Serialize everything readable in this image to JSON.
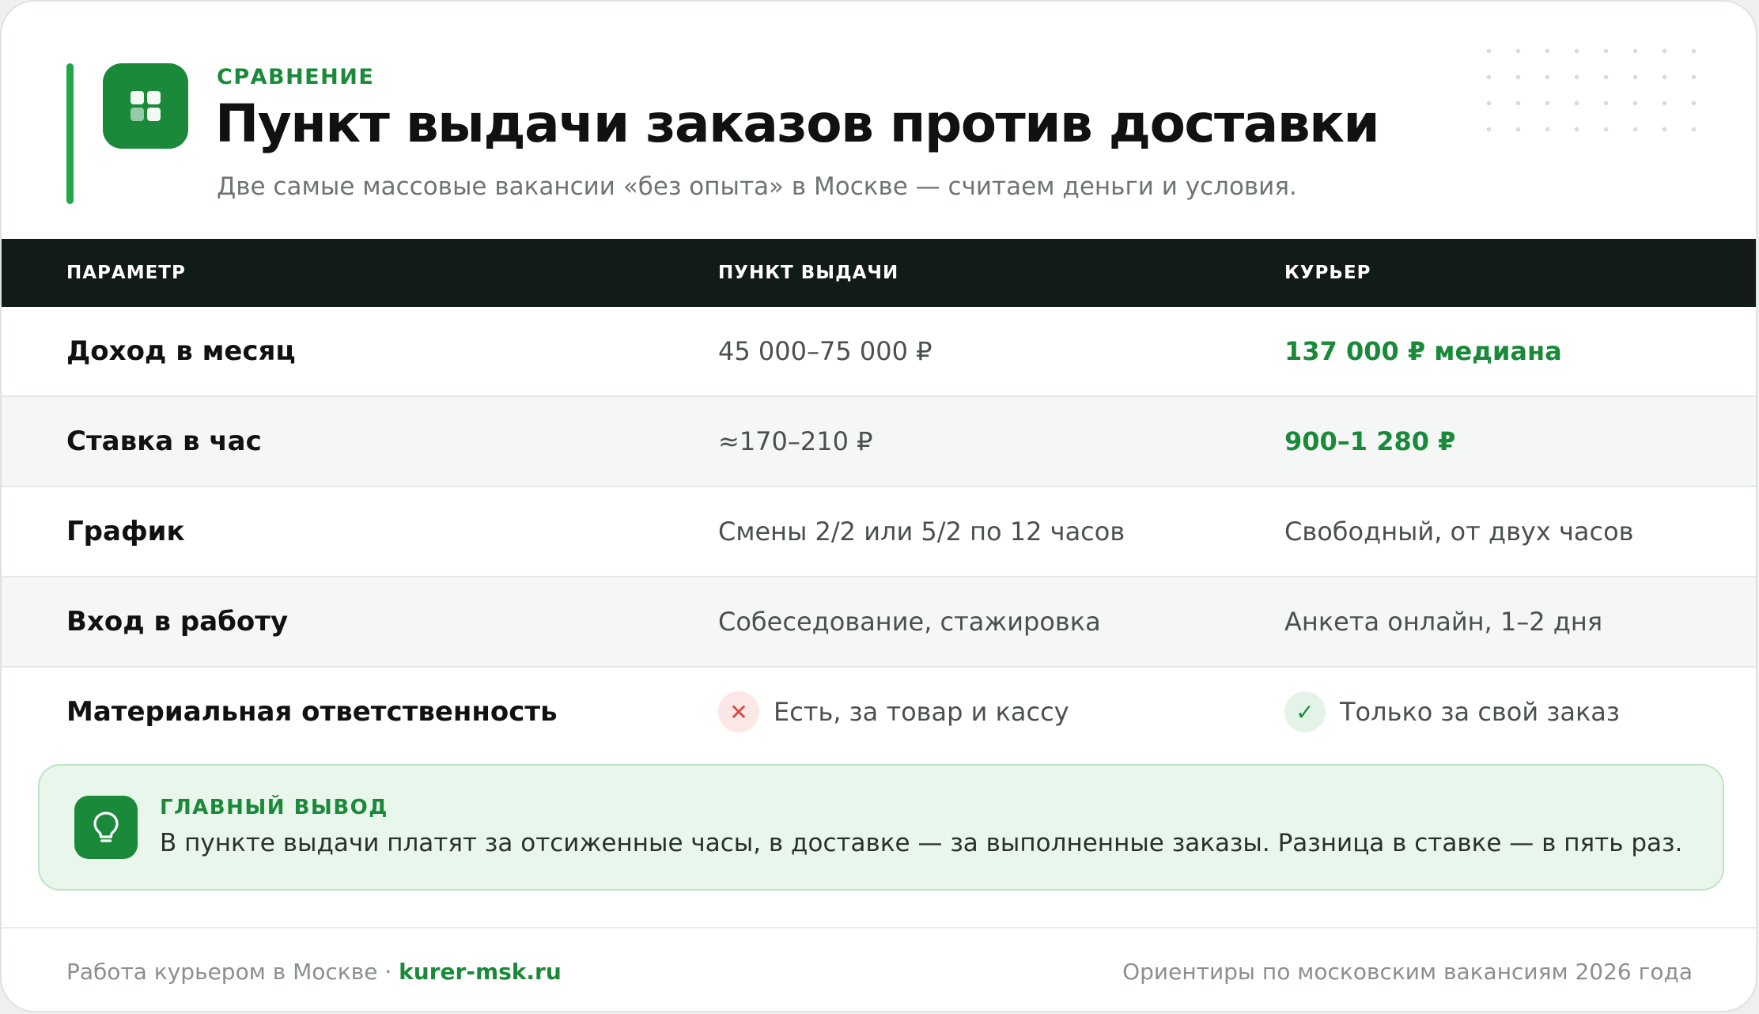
{
  "header": {
    "eyebrow": "СРАВНЕНИЕ",
    "title": "Пункт выдачи заказов против доставки",
    "subtitle": "Две самые массовые вакансии «без опыта» в Москве — считаем деньги и условия."
  },
  "table": {
    "columns": [
      "ПАРАМЕТР",
      "ПУНКТ ВЫДАЧИ",
      "КУРЬЕР"
    ],
    "rows": [
      {
        "param": "Доход в месяц",
        "pvz": "45 000–75 000 ₽",
        "courier": "137 000 ₽ медиана"
      },
      {
        "param": "Ставка в час",
        "pvz": "≈170–210 ₽",
        "courier": "900–1 280 ₽"
      },
      {
        "param": "График",
        "pvz": "Смены 2/2 или 5/2 по 12 часов",
        "courier": "Свободный, от двух часов"
      },
      {
        "param": "Вход в работу",
        "pvz": "Собеседование, стажировка",
        "courier": "Анкета онлайн, 1–2 дня"
      },
      {
        "param": "Материальная ответственность",
        "pvz": "Есть, за товар и кассу",
        "courier": "Только за свой заказ"
      }
    ]
  },
  "conclusion": {
    "label": "ГЛАВНЫЙ ВЫВОД",
    "text": "В пункте выдачи платят за отсиженные часы, в доставке — за выполненные заказы. Разница в ставке — в пять раз."
  },
  "footer": {
    "left_text": "Работа курьером в Москве ·",
    "site": "kurer-msk.ru",
    "right_text": "Ориентиры по московским вакансиям 2026 года"
  },
  "icons": {
    "logo": "grid-icon",
    "cross": "cross-icon",
    "check": "check-icon",
    "bulb": "lightbulb-icon"
  },
  "colors": {
    "accent": "#1a8a3a",
    "header_bg": "#121b17",
    "negative": "#d24a3e"
  }
}
